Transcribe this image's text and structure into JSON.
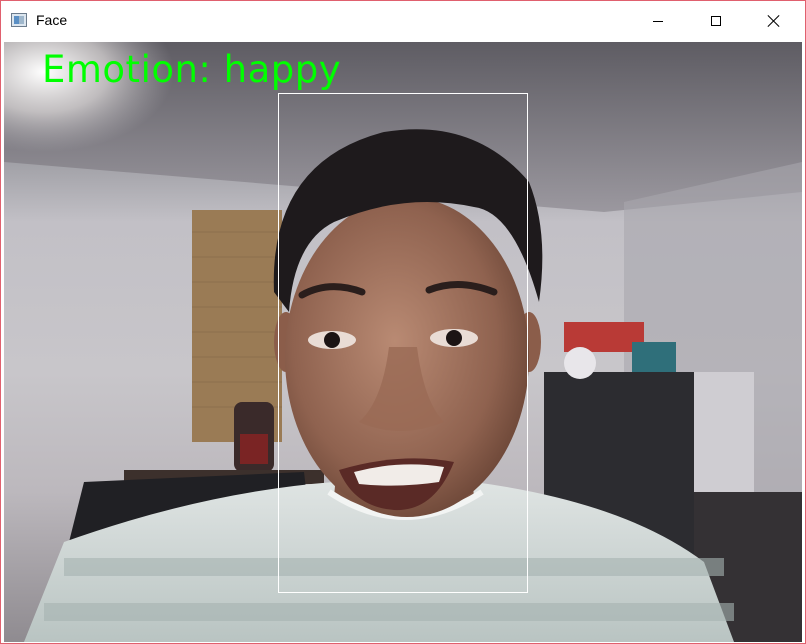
{
  "window": {
    "title": "Face",
    "controls": [
      "minimize",
      "maximize",
      "close"
    ]
  },
  "overlay": {
    "emotion_text": "Emotion: happy",
    "text_color": "#00ff00",
    "box_color": "#ffffff"
  },
  "icons": {
    "app": "app-icon",
    "minimize": "minimize-icon",
    "maximize": "maximize-icon",
    "close": "close-icon"
  }
}
